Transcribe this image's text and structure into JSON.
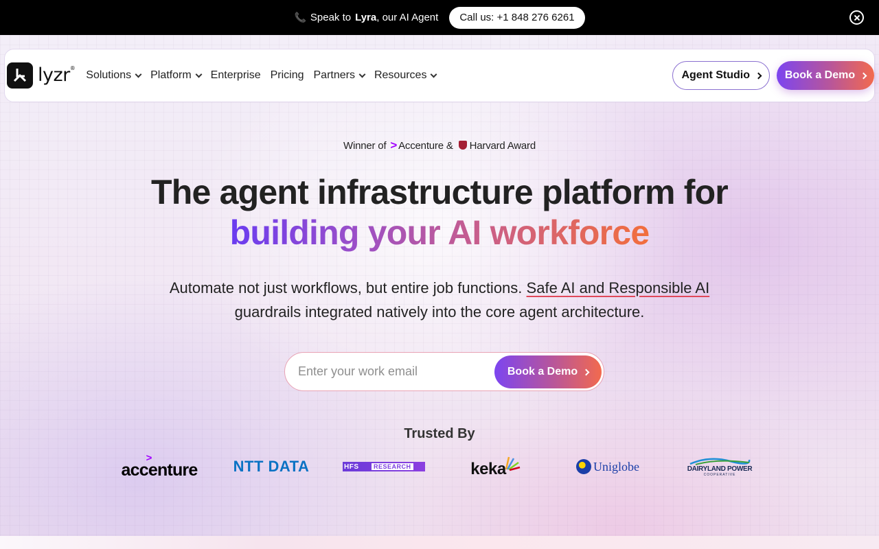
{
  "topbar": {
    "speak_prefix": "Speak to",
    "speak_name": "Lyra",
    "speak_suffix": ", our AI Agent",
    "call_label": "Call us: +1 848 276 6261"
  },
  "nav": {
    "logo_text": "lyzr",
    "logo_mark": "®",
    "items": [
      {
        "label": "Solutions",
        "dropdown": true
      },
      {
        "label": "Platform",
        "dropdown": true
      },
      {
        "label": "Enterprise",
        "dropdown": false
      },
      {
        "label": "Pricing",
        "dropdown": false
      },
      {
        "label": "Partners",
        "dropdown": true
      },
      {
        "label": "Resources",
        "dropdown": true
      }
    ],
    "agent_studio_label": "Agent Studio",
    "book_demo_label": "Book a Demo"
  },
  "hero": {
    "award_prefix": "Winner of",
    "award_accenture": "Accenture",
    "award_amp": "&",
    "award_harvard": "Harvard Award",
    "headline_line1": "The agent infrastructure platform for",
    "headline_line2": "building your AI workforce",
    "subtext_part1": "Automate not just workflows, but entire job functions.",
    "subtext_link": "Safe AI and Responsible AI",
    "subtext_part2": "guardrails integrated natively into the core agent architecture."
  },
  "form": {
    "email_placeholder": "Enter your work email",
    "email_value": "",
    "submit_label": "Book a Demo"
  },
  "trusted": {
    "heading": "Trusted By",
    "logos": {
      "accenture": "accenture",
      "ntt": "NTT DATA",
      "hfs_left": "HFS",
      "hfs_right": "RESEARCH",
      "keka": "keka",
      "uniglobe": "Uniglobe",
      "dairyland": "DAIRYLAND POWER",
      "dairyland_sub": "COOPERATIVE"
    }
  },
  "colors": {
    "accent_purple": "#7c45f0",
    "accent_orange": "#f26a4e",
    "accenture_purple": "#a100ff"
  }
}
